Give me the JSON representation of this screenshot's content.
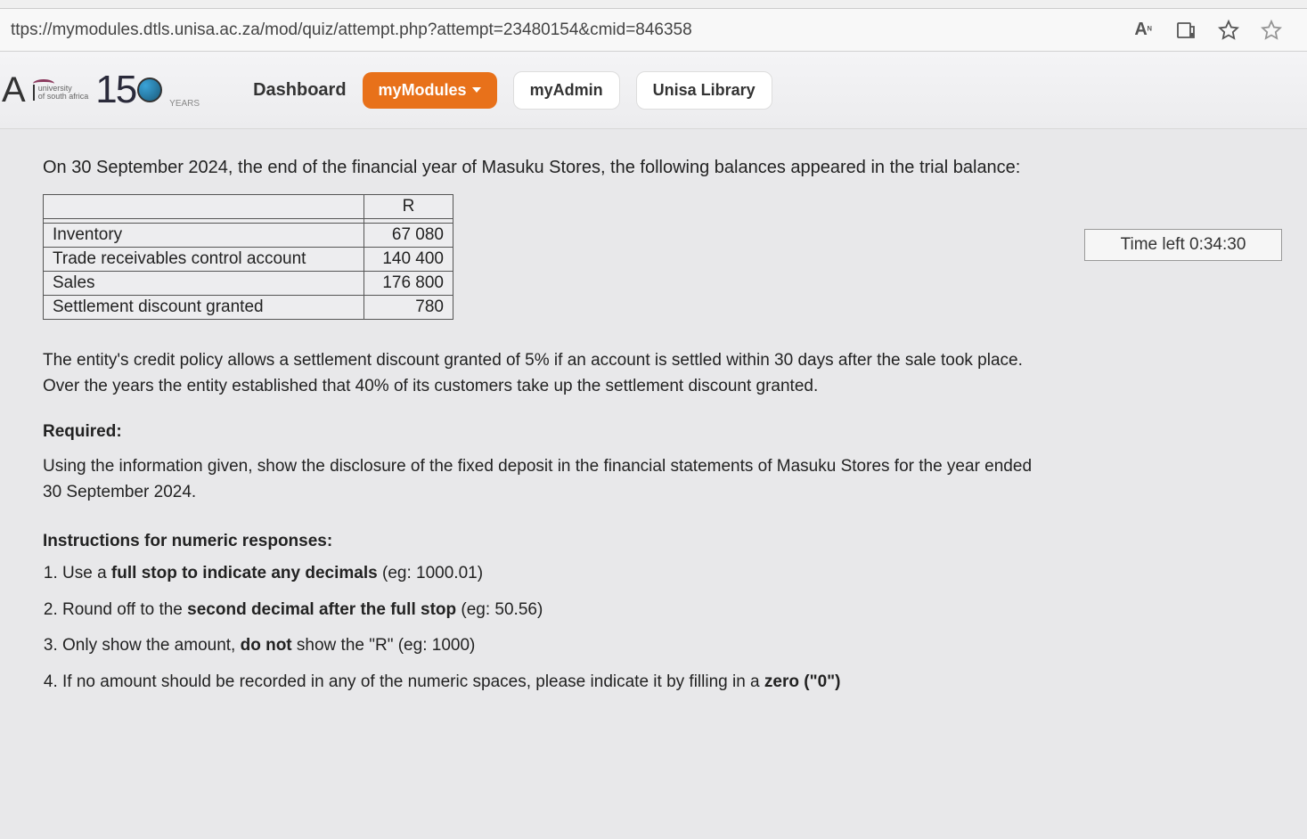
{
  "browser": {
    "url": "ttps://mymodules.dtls.unisa.ac.za/mod/quiz/attempt.php?attempt=23480154&cmid=846358",
    "text_icon_label": "A"
  },
  "logo": {
    "letter": "A",
    "sub1": "university",
    "sub2": "of south africa",
    "num": "15",
    "years": "YEARS"
  },
  "nav": {
    "dashboard": "Dashboard",
    "mymodules": "myModules",
    "myadmin": "myAdmin",
    "library": "Unisa Library"
  },
  "timer": {
    "label": "Time left 0:34:30"
  },
  "question": {
    "intro": "On 30 September 2024, the end of the financial year of Masuku Stores, the following balances appeared in the trial balance:",
    "table": {
      "header_r": "R",
      "rows": [
        {
          "label": "Inventory",
          "value": "67 080"
        },
        {
          "label": "Trade receivables control account",
          "value": "140 400"
        },
        {
          "label": "Sales",
          "value": "176 800"
        },
        {
          "label": "Settlement discount granted",
          "value": "780"
        }
      ]
    },
    "policy": "The entity's credit policy allows a settlement discount granted of 5% if an account is settled within 30 days after the sale took place. Over the years the entity established that 40% of its customers take up the settlement discount granted.",
    "required_heading": "Required:",
    "required_text": "Using the information given, show the disclosure of the fixed deposit in the financial statements of Masuku Stores for the year ended 30 September 2024.",
    "instructions_heading": "Instructions for numeric responses:",
    "instructions": {
      "i1a": "Use a ",
      "i1b": "full stop to indicate any decimals",
      "i1c": " (eg: 1000.01)",
      "i2a": " Round off to the ",
      "i2b": "second decimal after the full stop",
      "i2c": " (eg: 50.56)",
      "i3a": "Only show the amount, ",
      "i3b": "do not",
      "i3c": " show the \"R\" (eg: 1000)",
      "i4a": "If no amount should be recorded in any of the numeric spaces, please indicate it by filling in a ",
      "i4b": "zero (\"0\")"
    }
  }
}
